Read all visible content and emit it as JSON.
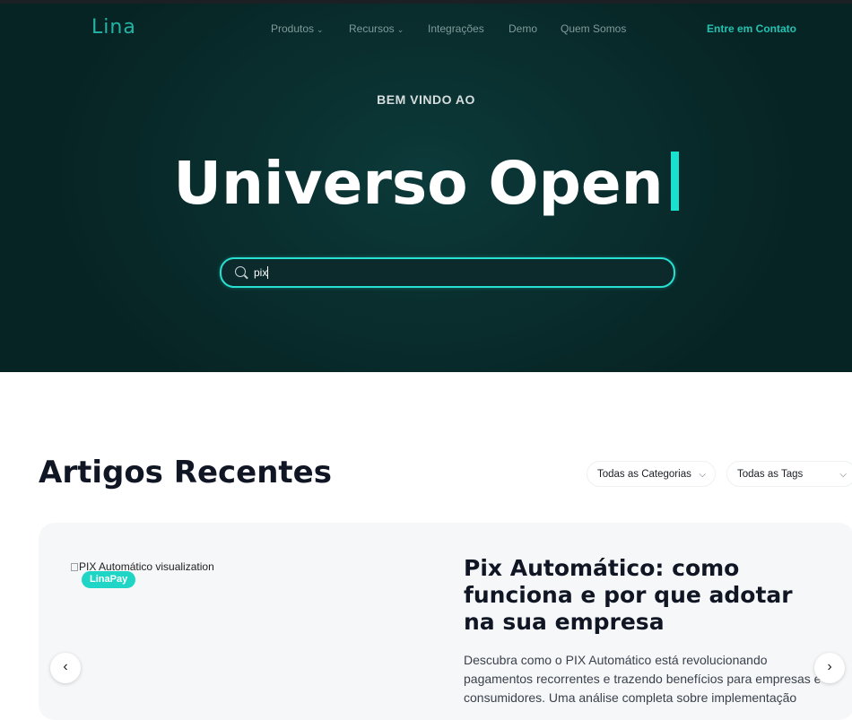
{
  "header": {
    "logo": "Lina",
    "nav": [
      {
        "label": "Produtos",
        "has_dropdown": true
      },
      {
        "label": "Recursos",
        "has_dropdown": true
      },
      {
        "label": "Integrações",
        "has_dropdown": false
      },
      {
        "label": "Demo",
        "has_dropdown": false
      },
      {
        "label": "Quem Somos",
        "has_dropdown": false
      }
    ],
    "contact_label": "Entre em Contato"
  },
  "hero": {
    "welcome": "BEM VINDO AO",
    "headline": "Universo Open",
    "search_value": "pix"
  },
  "articles": {
    "title": "Artigos Recentes",
    "filters": {
      "categories_label": "Todas as Categorias",
      "tags_label": "Todas as Tags"
    },
    "featured": {
      "image_alt": "PIX Automático visualization",
      "badge": "LinaPay",
      "title": "Pix Automático: como funciona e por que adotar na sua empresa",
      "description": "Descubra como o PIX Automático está revolucionando pagamentos recorrentes e trazendo benefícios para empresas e consumidores. Uma análise completa sobre implementação"
    },
    "prev_icon": "chevron-left",
    "next_icon": "chevron-right"
  },
  "colors": {
    "accent": "#22c3b3",
    "hero_bg": "#0a2f2f",
    "badge": "#1fd6c6",
    "heading": "#101624"
  }
}
